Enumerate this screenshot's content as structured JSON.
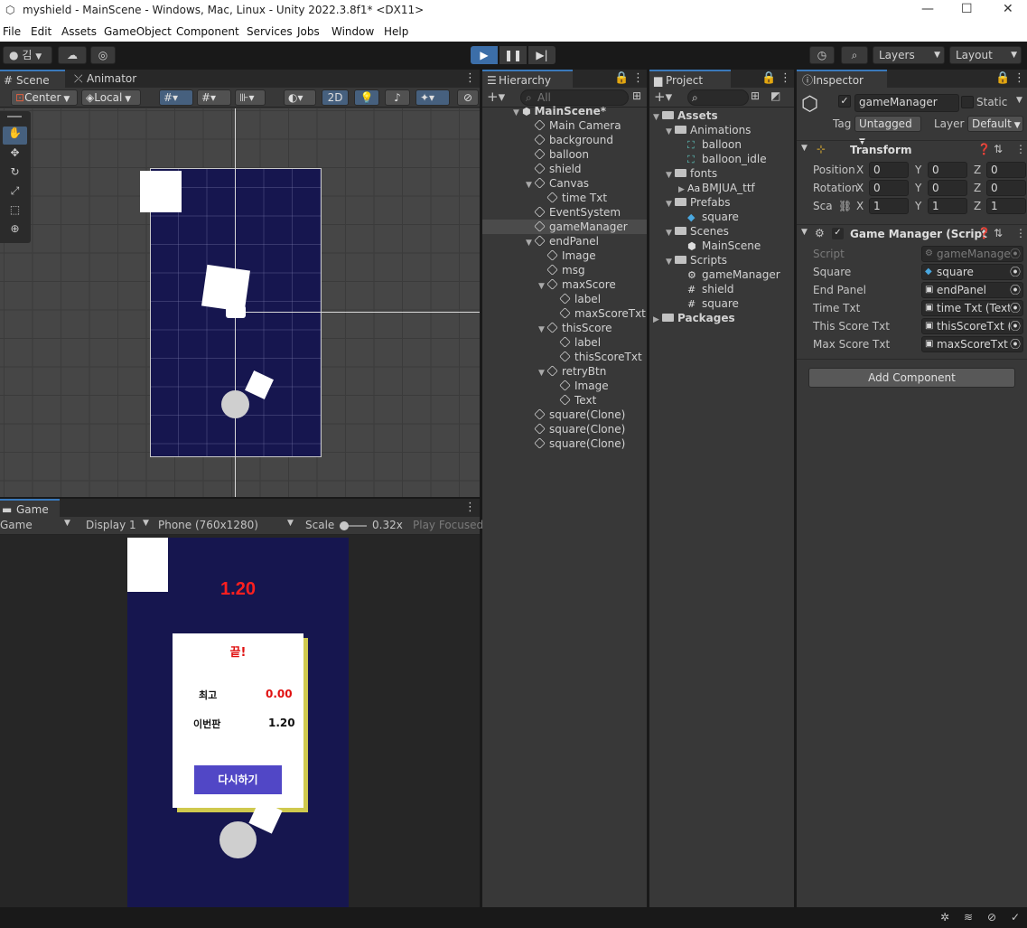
{
  "window": {
    "title": "myshield - MainScene - Windows, Mac, Linux - Unity 2022.3.8f1* <DX11>"
  },
  "menu": [
    "File",
    "Edit",
    "Assets",
    "GameObject",
    "Component",
    "Services",
    "Jobs",
    "Window",
    "Help"
  ],
  "toolbar": {
    "account": "김",
    "layers": "Layers",
    "layout": "Layout"
  },
  "scene": {
    "tab_scene": "Scene",
    "tab_animator": "Animator",
    "pivot": "Center",
    "space": "Local",
    "mode2d": "2D"
  },
  "game": {
    "tab": "Game",
    "view": "Game",
    "display": "Display 1",
    "resolution": "Phone (760x1280)",
    "scale_label": "Scale",
    "scale_value": "0.32x",
    "play_mode": "Play Focused",
    "timer": "1.20",
    "panel_title": "끝!",
    "best_label": "최고",
    "best_value": "0.00",
    "this_label": "이번판",
    "this_value": "1.20",
    "retry_label": "다시하기"
  },
  "hierarchy": {
    "tab": "Hierarchy",
    "search_placeholder": "All",
    "scene_name": "MainScene*",
    "items": [
      {
        "label": "Main Camera",
        "depth": 1
      },
      {
        "label": "background",
        "depth": 1
      },
      {
        "label": "balloon",
        "depth": 1
      },
      {
        "label": "shield",
        "depth": 1
      },
      {
        "label": "Canvas",
        "depth": 1,
        "expanded": true
      },
      {
        "label": "time Txt",
        "depth": 2
      },
      {
        "label": "EventSystem",
        "depth": 1
      },
      {
        "label": "gameManager",
        "depth": 1,
        "selected": true
      },
      {
        "label": "endPanel",
        "depth": 1,
        "expanded": true
      },
      {
        "label": "Image",
        "depth": 2
      },
      {
        "label": "msg",
        "depth": 2
      },
      {
        "label": "maxScore",
        "depth": 2,
        "expanded": true
      },
      {
        "label": "label",
        "depth": 3
      },
      {
        "label": "maxScoreTxt",
        "depth": 3
      },
      {
        "label": "thisScore",
        "depth": 2,
        "expanded": true
      },
      {
        "label": "label",
        "depth": 3
      },
      {
        "label": "thisScoreTxt",
        "depth": 3
      },
      {
        "label": "retryBtn",
        "depth": 2,
        "expanded": true
      },
      {
        "label": "Image",
        "depth": 3
      },
      {
        "label": "Text",
        "depth": 3
      },
      {
        "label": "square(Clone)",
        "depth": 1
      },
      {
        "label": "square(Clone)",
        "depth": 1
      },
      {
        "label": "square(Clone)",
        "depth": 1
      }
    ]
  },
  "project": {
    "tab": "Project",
    "items": [
      {
        "label": "Assets",
        "depth": 0,
        "type": "folder",
        "expanded": true
      },
      {
        "label": "Animations",
        "depth": 1,
        "type": "folder",
        "expanded": true
      },
      {
        "label": "balloon",
        "depth": 2,
        "type": "anim"
      },
      {
        "label": "balloon_idle",
        "depth": 2,
        "type": "anim"
      },
      {
        "label": "fonts",
        "depth": 1,
        "type": "folder",
        "expanded": true
      },
      {
        "label": "BMJUA_ttf",
        "depth": 2,
        "type": "font",
        "collapsed": true
      },
      {
        "label": "Prefabs",
        "depth": 1,
        "type": "folder",
        "expanded": true
      },
      {
        "label": "square",
        "depth": 2,
        "type": "prefab"
      },
      {
        "label": "Scenes",
        "depth": 1,
        "type": "folder",
        "expanded": true
      },
      {
        "label": "MainScene",
        "depth": 2,
        "type": "scene"
      },
      {
        "label": "Scripts",
        "depth": 1,
        "type": "folder",
        "expanded": true
      },
      {
        "label": "gameManager",
        "depth": 2,
        "type": "gear"
      },
      {
        "label": "shield",
        "depth": 2,
        "type": "script"
      },
      {
        "label": "square",
        "depth": 2,
        "type": "script"
      },
      {
        "label": "Packages",
        "depth": 0,
        "type": "folder",
        "expanded": false
      }
    ]
  },
  "inspector": {
    "tab": "Inspector",
    "object_name": "gameManager",
    "static_label": "Static",
    "tag_label": "Tag",
    "tag_value": "Untagged",
    "layer_label": "Layer",
    "layer_value": "Default",
    "transform": {
      "title": "Transform",
      "position": {
        "label": "Position",
        "x": "0",
        "y": "0",
        "z": "0"
      },
      "rotation": {
        "label": "Rotation",
        "x": "0",
        "y": "0",
        "z": "0"
      },
      "scale": {
        "label": "Sca",
        "x": "1",
        "y": "1",
        "z": "1"
      }
    },
    "script_component": {
      "title": "Game Manager (Script",
      "fields": [
        {
          "label": "Script",
          "value": "gameManager",
          "disabled": true
        },
        {
          "label": "Square",
          "value": "square"
        },
        {
          "label": "End Panel",
          "value": "endPanel"
        },
        {
          "label": "Time Txt",
          "value": "time Txt (Text"
        },
        {
          "label": "This Score Txt",
          "value": "thisScoreTxt ("
        },
        {
          "label": "Max Score Txt",
          "value": "maxScoreTxt"
        }
      ]
    },
    "add_component": "Add Component"
  }
}
